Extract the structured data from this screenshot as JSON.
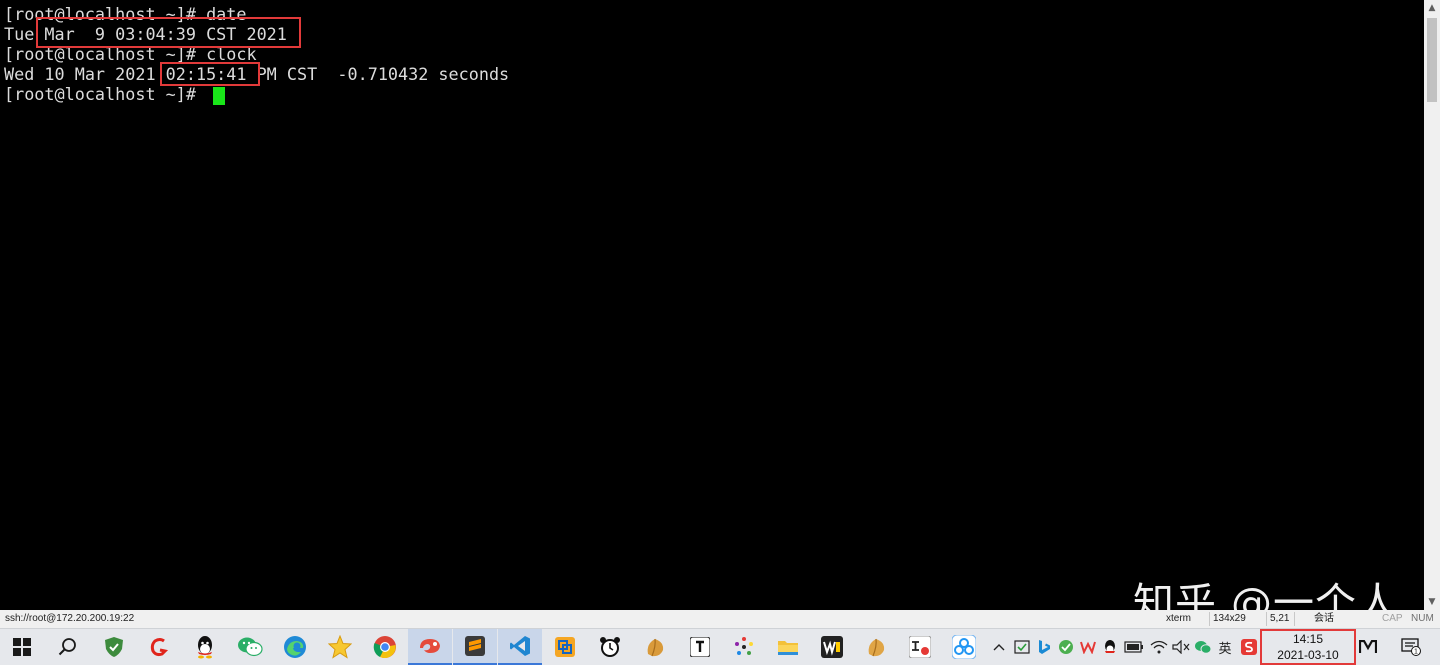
{
  "terminal": {
    "lines": [
      "[root@localhost ~]# date",
      "Tue Mar  9 03:04:39 CST 2021",
      "[root@localhost ~]# clock",
      "Wed 10 Mar 2021 02:15:41 PM CST  -0.710432 seconds",
      "[root@localhost ~]#"
    ],
    "colors": {
      "text": "#dcdcdc",
      "cursor": "#19e619",
      "highlight": "#e23a3a",
      "background": "#000000"
    }
  },
  "statusbar": {
    "connection": "ssh://root@172.20.200.19:22",
    "term": "xterm",
    "size": "134x29",
    "position": "5,21",
    "sessions": "会话",
    "caps": "CAP",
    "num": "NUM"
  },
  "watermark": "知乎 @一个人",
  "taskbar": {
    "icons": [
      "windows-start",
      "search",
      "shield",
      "game",
      "qq",
      "wechat",
      "edge",
      "star",
      "chrome",
      "xshell",
      "sublime-text",
      "vscode",
      "box",
      "alarm-clock",
      "nut",
      "typora",
      "dots",
      "file-explorer",
      "wps",
      "nut-2",
      "work-app",
      "network-app"
    ],
    "tray": {
      "ime": "英"
    },
    "clock": {
      "time": "14:15",
      "date": "2021-03-10"
    }
  }
}
